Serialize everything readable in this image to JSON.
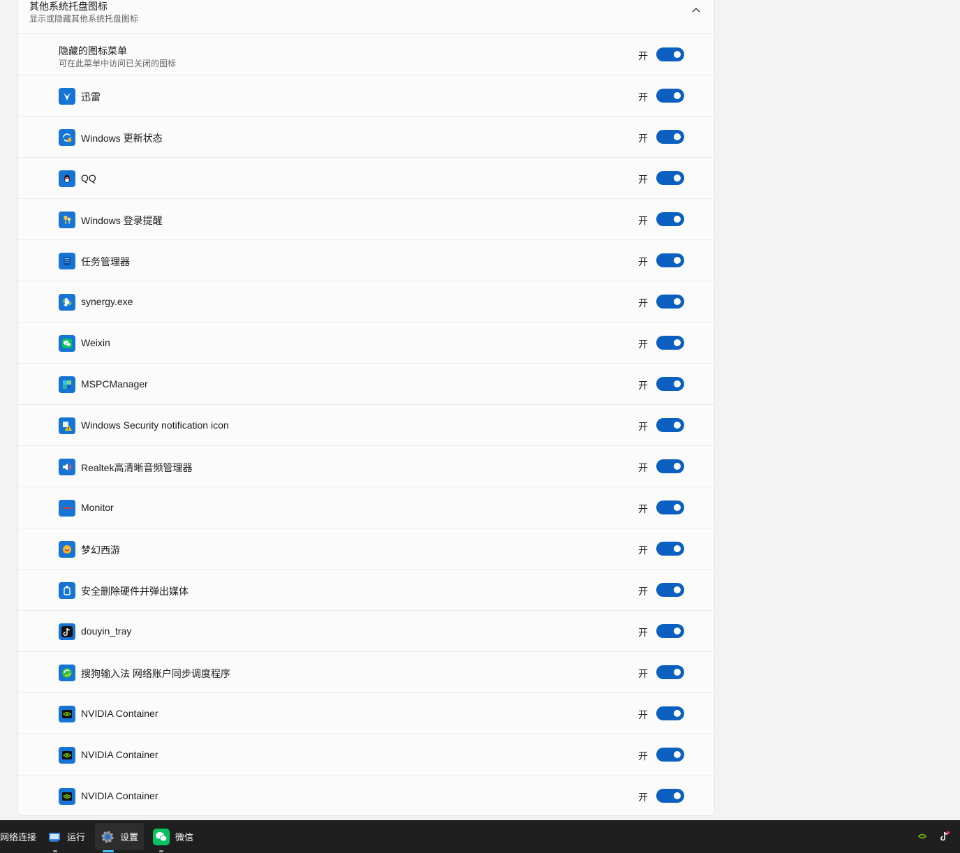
{
  "section": {
    "title": "其他系统托盘图标",
    "subtitle": "显示或隐藏其他系统托盘图标"
  },
  "hidden_menu": {
    "title": "隐藏的图标菜单",
    "subtitle": "可在此菜单中访问已关闭的图标",
    "state": "开",
    "on": true
  },
  "items": [
    {
      "label": "迅雷",
      "state": "开",
      "on": true,
      "icon": "thunder-icon"
    },
    {
      "label": "Windows 更新状态",
      "state": "开",
      "on": true,
      "icon": "windows-update-icon"
    },
    {
      "label": "QQ",
      "state": "开",
      "on": true,
      "icon": "qq-penguin-icon"
    },
    {
      "label": "Windows 登录提醒",
      "state": "开",
      "on": true,
      "icon": "keys-icon"
    },
    {
      "label": "任务管理器",
      "state": "开",
      "on": true,
      "icon": "task-manager-icon"
    },
    {
      "label": "synergy.exe",
      "state": "开",
      "on": true,
      "icon": "synergy-icon"
    },
    {
      "label": "Weixin",
      "state": "开",
      "on": true,
      "icon": "weixin-icon"
    },
    {
      "label": "MSPCManager",
      "state": "开",
      "on": true,
      "icon": "pc-manager-icon"
    },
    {
      "label": "Windows Security notification icon",
      "state": "开",
      "on": true,
      "icon": "security-warning-icon"
    },
    {
      "label": "Realtek高清晰音频管理器",
      "state": "开",
      "on": true,
      "icon": "speaker-icon"
    },
    {
      "label": "Monitor",
      "state": "开",
      "on": true,
      "icon": "monitor-icon"
    },
    {
      "label": "梦幻西游",
      "state": "开",
      "on": true,
      "icon": "game-icon"
    },
    {
      "label": "安全删除硬件并弹出媒体",
      "state": "开",
      "on": true,
      "icon": "usb-eject-icon"
    },
    {
      "label": "douyin_tray",
      "state": "开",
      "on": true,
      "icon": "douyin-icon"
    },
    {
      "label": "搜狗输入法 网络账户同步调度程序",
      "state": "开",
      "on": true,
      "icon": "sync-icon"
    },
    {
      "label": "NVIDIA Container",
      "state": "开",
      "on": true,
      "icon": "nvidia-icon"
    },
    {
      "label": "NVIDIA Container",
      "state": "开",
      "on": true,
      "icon": "nvidia-icon"
    },
    {
      "label": "NVIDIA Container",
      "state": "开",
      "on": true,
      "icon": "nvidia-icon"
    }
  ],
  "taskbar": {
    "items": [
      {
        "label": "网络连接",
        "icon": "network-icon"
      },
      {
        "label": "运行",
        "icon": "run-icon"
      },
      {
        "label": "设置",
        "icon": "settings-gear-icon",
        "active": true
      },
      {
        "label": "微信",
        "icon": "wechat-icon"
      }
    ],
    "tray": [
      "nvidia-icon",
      "douyin-icon"
    ]
  },
  "colors": {
    "accent": "#0a5fc0",
    "icon_bg": "#1574d4",
    "panel_bg": "#fbfbfb",
    "taskbar_bg": "#1f1f1f"
  }
}
